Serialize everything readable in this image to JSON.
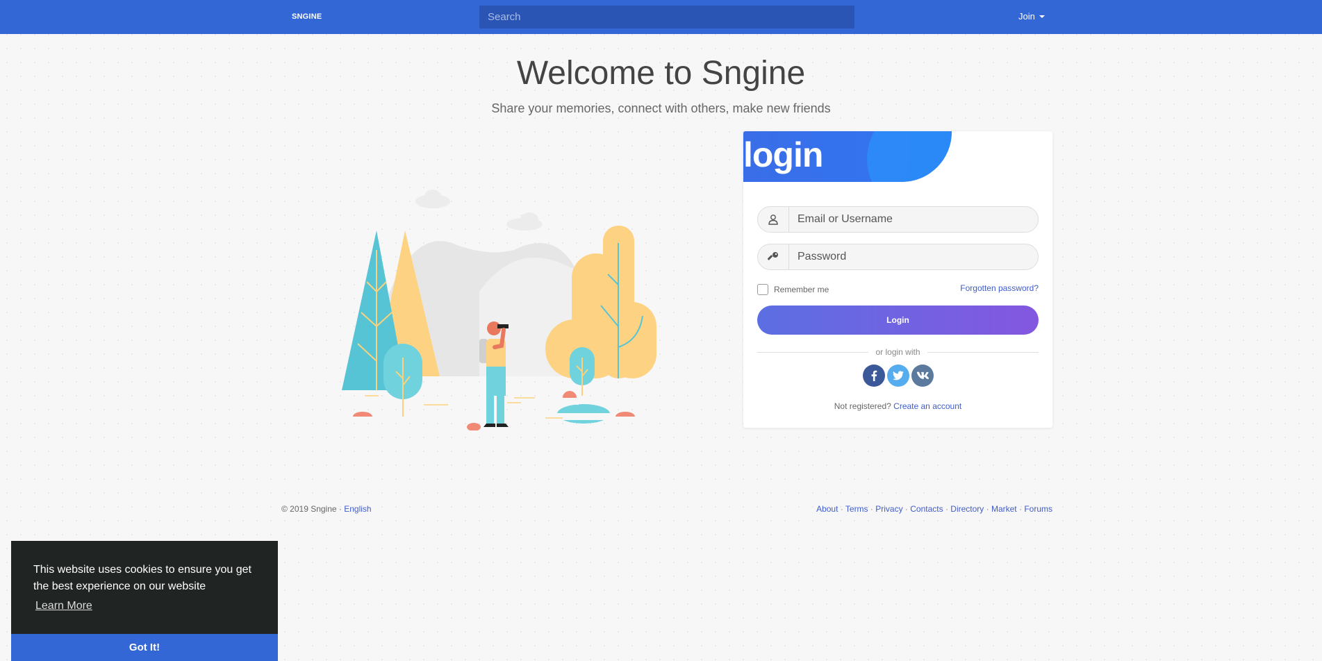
{
  "navbar": {
    "brand": "SNGINE",
    "search_placeholder": "Search",
    "join_label": "Join"
  },
  "hero": {
    "title": "Welcome to Sngine",
    "subtitle": "Share your memories, connect with others, make new friends"
  },
  "login": {
    "title": "login",
    "username_placeholder": "Email or Username",
    "password_placeholder": "Password",
    "remember_label": "Remember me",
    "forgot_label": "Forgotten password?",
    "submit_label": "Login",
    "divider_label": "or login with",
    "social": [
      {
        "name": "facebook",
        "glyph": "f"
      },
      {
        "name": "twitter",
        "glyph": "t"
      },
      {
        "name": "vk",
        "glyph": "vk"
      }
    ],
    "not_registered": "Not registered?",
    "create_account": "Create an account"
  },
  "footer": {
    "copyright": "© 2019 Sngine ·",
    "language": "English",
    "links": [
      "About",
      "Terms",
      "Privacy",
      "Contacts",
      "Directory",
      "Market",
      "Forums"
    ]
  },
  "cookie": {
    "message": "This website uses cookies to ensure you get the best experience on our website",
    "learn_more": "Learn More",
    "accept": "Got It!"
  },
  "colors": {
    "primary": "#3367d6",
    "link": "#3f5cc8",
    "button_start": "#5c6fe2",
    "button_end": "#8457e0",
    "cookie_bg": "#202423"
  }
}
